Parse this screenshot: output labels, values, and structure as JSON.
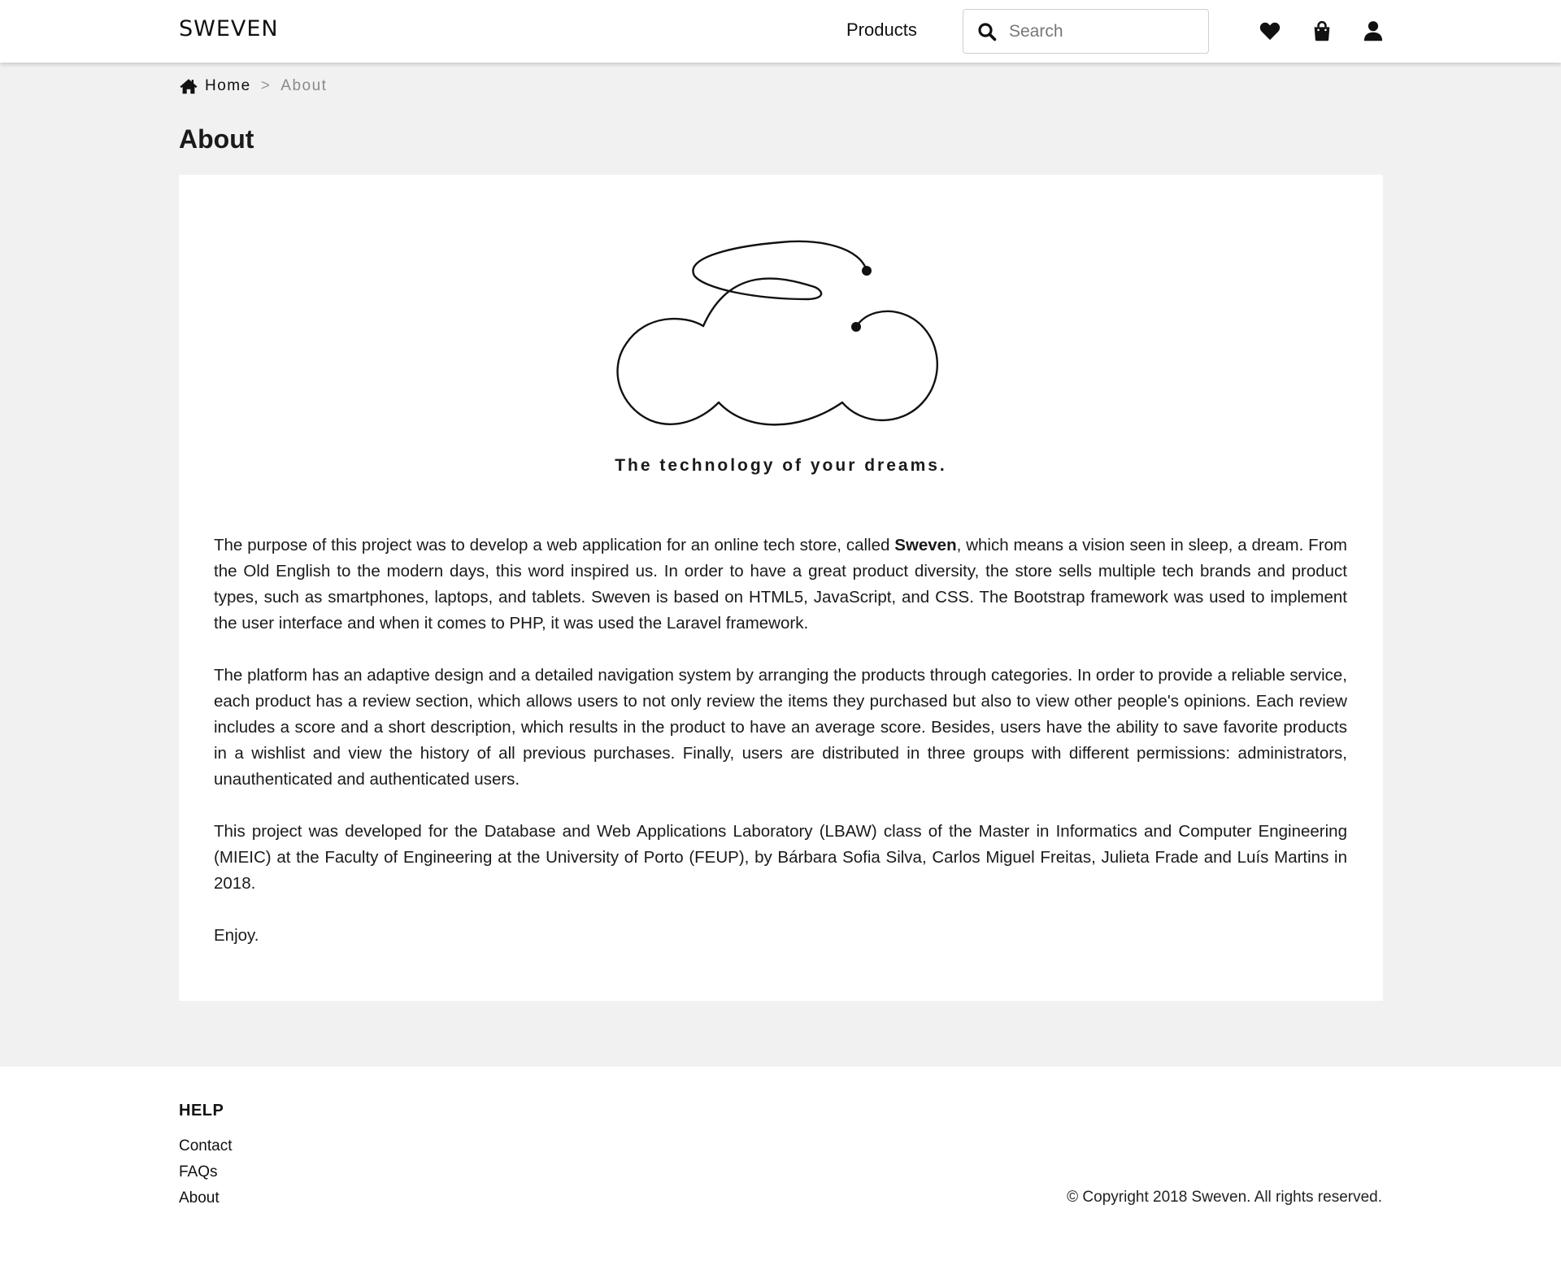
{
  "navbar": {
    "brand": "SWEVEN",
    "products_label": "Products",
    "search_placeholder": "Search",
    "icons": [
      "heart-icon",
      "shopping-bag-icon",
      "user-icon"
    ]
  },
  "breadcrumb": {
    "home_label": "Home",
    "separator": ">",
    "current_label": "About"
  },
  "page": {
    "title": "About",
    "tagline": "The technology of your dreams.",
    "paragraph1": {
      "before": "The purpose of this project was to develop a web application for an online tech store, called ",
      "bold": "Sweven",
      "after": ", which means a vision seen in sleep, a dream. From the Old English to the modern days, this word inspired us. In order to have a great product diversity, the store sells multiple tech brands and product types, such as smartphones, laptops, and tablets. Sweven is based on HTML5, JavaScript, and CSS. The Bootstrap framework was used to implement the user interface and when it comes to PHP, it was used the Laravel framework."
    },
    "paragraph2": "The platform has an adaptive design and a detailed navigation system by arranging the products through categories. In order to provide a reliable service, each product has a review section, which allows users to not only review the items they purchased but also to view other people's opinions. Each review includes a score and a short description, which results in the product to have an average score. Besides, users have the ability to save favorite products in a wishlist and view the history of all previous purchases. Finally, users are distributed in three groups with different permissions: administrators, unauthenticated and authenticated users.",
    "paragraph3": "This project was developed for the Database and Web Applications Laboratory (LBAW) class of the Master in Informatics and Computer Engineering (MIEIC) at the Faculty of Engineering at the University of Porto (FEUP), by Bárbara Sofia Silva, Carlos Miguel Freitas, Julieta Frade and Luís Martins in 2018.",
    "paragraph4": "Enjoy."
  },
  "footer": {
    "heading": "HELP",
    "links": [
      "Contact",
      "FAQs",
      "About"
    ],
    "copyright": "© Copyright 2018 Sweven. All rights reserved."
  },
  "colors": {
    "page_background": "#f1f1f1",
    "card_background": "#ffffff",
    "text": "#1a1a1a",
    "muted": "#8a8a8a"
  }
}
